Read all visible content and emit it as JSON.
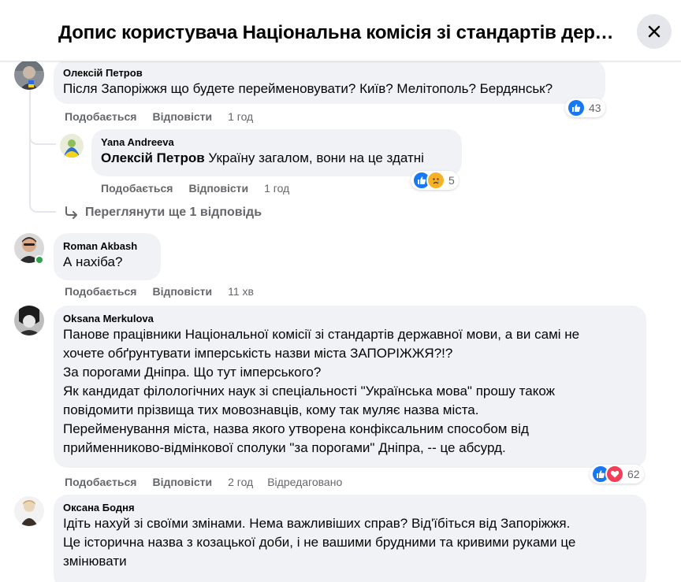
{
  "header": {
    "title": "Допис користувача Національна комісія зі стандартів державної мови",
    "close_icon": "close-icon"
  },
  "colors": {
    "like_blue": "#1877f2",
    "love_red": "#f33e58",
    "sad_yellow": "#f7b125",
    "bubble_gray": "#f0f2f5",
    "meta_gray": "#65676b",
    "online_green": "#31a24c"
  },
  "comments": [
    {
      "author": "Олексій Петров",
      "text": "Після Запоріжжя що будете перейменовувати? Київ? Мелітополь? Бердянськ?",
      "actions": {
        "like": "Подобається",
        "reply": "Відповісти",
        "time": "1 год"
      },
      "reactions": {
        "icons": [
          "like"
        ],
        "count": "43"
      },
      "replies": [
        {
          "author": "Yana Andreeva",
          "mention": "Олексій Петров",
          "text": "Україну загалом, вони на це здатні",
          "actions": {
            "like": "Подобається",
            "reply": "Відповісти",
            "time": "1 год"
          },
          "reactions": {
            "icons": [
              "like",
              "sad"
            ],
            "count": "5"
          }
        }
      ],
      "more_replies": "Переглянути ще 1 відповідь"
    },
    {
      "author": "Roman Akbash",
      "text": "А нахіба?",
      "actions": {
        "like": "Подобається",
        "reply": "Відповісти",
        "time": "11 хв"
      }
    },
    {
      "author": "Oksana Merkulova",
      "lines": [
        "Панове працівники Національної комісії зі стандартів державної мови, а ви самі не",
        "хочете обґрунтувати імперськість назви міста ЗАПОРІЖЖЯ?!?",
        "За порогами Дніпра. Що тут імперського?",
        "Як кандидат філологічних наук зі спеціальності \"Українська мова\" прошу також",
        "повідомити прізвища тих мовознавців, кому так муляє назва міста.",
        "Перейменування міста, назва якого утворена конфіксальним способом від",
        "прийменниково-відмінкової сполуки \"за порогами\" Дніпра, -- це абсурд."
      ],
      "actions": {
        "like": "Подобається",
        "reply": "Відповісти",
        "time": "2 год",
        "edited": "Відредаговано"
      },
      "reactions": {
        "icons": [
          "like",
          "love"
        ],
        "count": "62"
      }
    },
    {
      "author": "Оксана Бодня",
      "lines": [
        "Ідіть нахуй зі своїми змінами. Нема важливіших справ? Від'їбіться від Запоріжжя.",
        "Це історична назва з козацької доби, і не вашими брудними та кривими руками це",
        "змінювати"
      ]
    }
  ]
}
